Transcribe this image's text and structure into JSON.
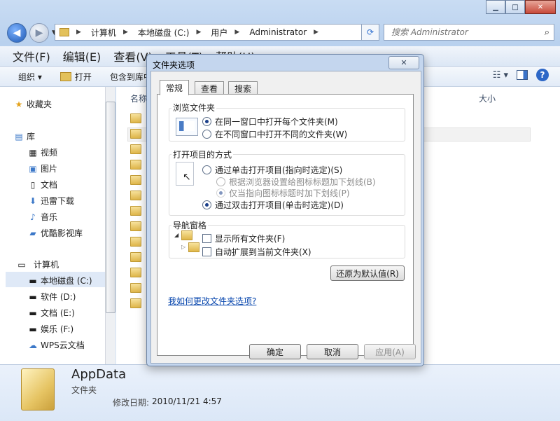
{
  "explorer": {
    "address": {
      "crumbs": [
        "计算机",
        "本地磁盘 (C:)",
        "用户",
        "Administrator"
      ]
    },
    "search_placeholder": "搜索 Administrator",
    "menu": [
      "文件(F)",
      "编辑(E)",
      "查看(V)",
      "工具(T)",
      "帮助(H)"
    ],
    "toolbar": {
      "organize": "组织 ▾",
      "open": "打开",
      "include": "包含到库中"
    },
    "column_name": "名称",
    "column_size": "大小",
    "sidebar": {
      "favorites": "收藏夹",
      "libraries": "库",
      "lib_items": [
        "视频",
        "图片",
        "文档",
        "迅雷下载",
        "音乐",
        "优酷影视库"
      ],
      "computer": "计算机",
      "drives": [
        "本地磁盘 (C:)",
        "软件 (D:)",
        "文档 (E:)",
        "娱乐 (F:)",
        "WPS云文档"
      ]
    },
    "details": {
      "name": "AppData",
      "type": "文件夹",
      "modified_label": "修改日期:",
      "modified_value": "2010/11/21 4:57"
    }
  },
  "dialog": {
    "title": "文件夹选项",
    "close": "✕",
    "tabs": [
      "常规",
      "查看",
      "搜索"
    ],
    "browse": {
      "title": "浏览文件夹",
      "opt1": "在同一窗口中打开每个文件夹(M)",
      "opt2": "在不同窗口中打开不同的文件夹(W)"
    },
    "click": {
      "title": "打开项目的方式",
      "opt1": "通过单击打开项目(指向时选定)(S)",
      "sub1": "根据浏览器设置给图标标题加下划线(B)",
      "sub2": "仅当指向图标标题时加下划线(P)",
      "opt2": "通过双击打开项目(单击时选定)(D)"
    },
    "nav": {
      "title": "导航窗格",
      "opt1": "显示所有文件夹(F)",
      "opt2": "自动扩展到当前文件夹(X)"
    },
    "restore": "还原为默认值(R)",
    "help_link": "我如何更改文件夹选项?",
    "ok": "确定",
    "cancel": "取消",
    "apply": "应用(A)"
  }
}
